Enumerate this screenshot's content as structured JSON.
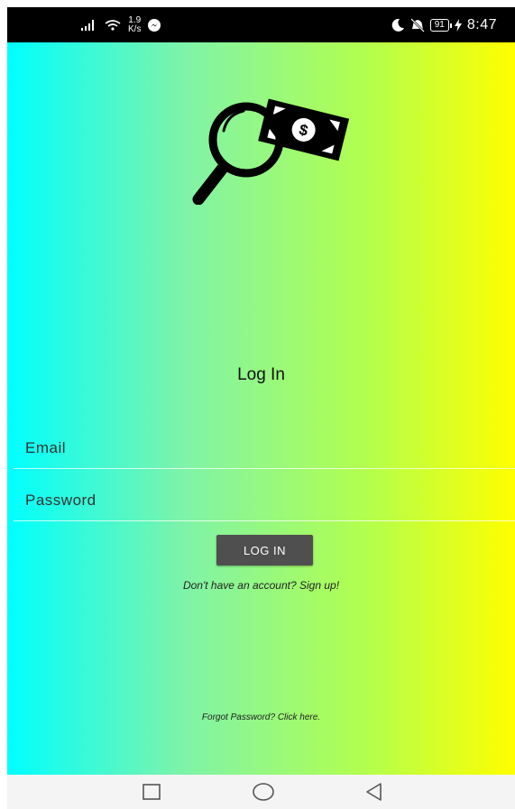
{
  "status_bar": {
    "signal_icon": "signal-bars-icon",
    "wifi_icon": "wifi-icon",
    "netspeed_value": "1.9",
    "netspeed_unit": "K/s",
    "messenger_icon": "messenger-icon",
    "moon_icon": "moon-icon",
    "mute_icon": "bell-off-icon",
    "battery_level": "91",
    "charging_icon": "bolt-icon",
    "time": "8:47"
  },
  "app": {
    "logo_icon": "magnifier-money-icon",
    "title": "Log In",
    "email": {
      "placeholder": "Email",
      "value": ""
    },
    "password": {
      "placeholder": "Password",
      "value": ""
    },
    "login_button_label": "LOG IN",
    "signup_link": "Don't have an account? Sign up!",
    "forgot_link": "Forgot Password? Click here.",
    "gradient_colors": [
      "#00ffff",
      "#b5ff4a",
      "#ffff00"
    ]
  },
  "nav_bar": {
    "recents_icon": "square-icon",
    "home_icon": "circle-icon",
    "back_icon": "triangle-back-icon"
  }
}
